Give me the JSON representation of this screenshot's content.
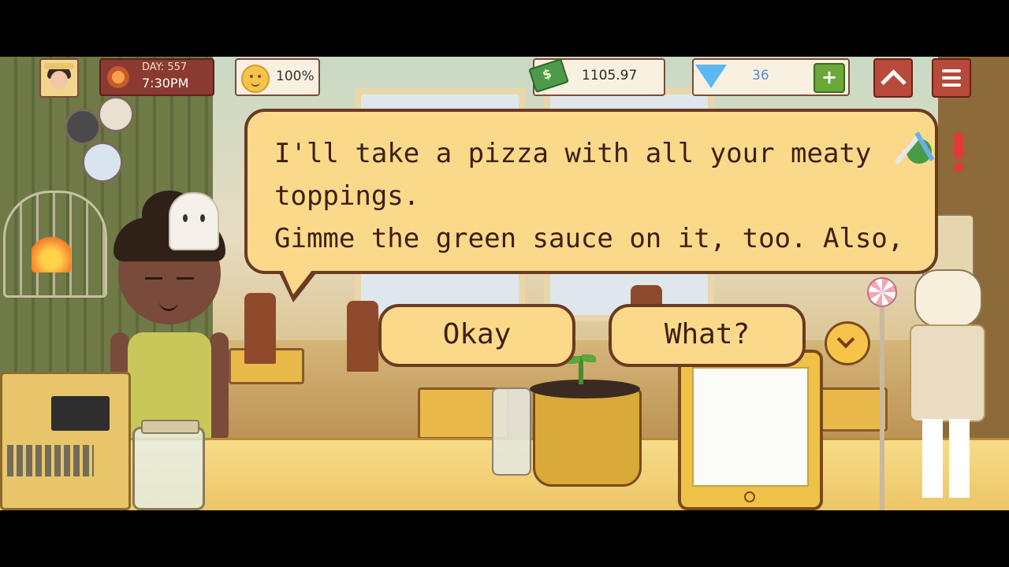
{
  "hud": {
    "day": "DAY: 557",
    "time": "7:30PM",
    "mood": "100%",
    "money": "1105.97",
    "gems": "36",
    "gem_plus": "+"
  },
  "dialog": {
    "text": "I'll take a pizza with all your meaty toppings.\nGimme the green sauce on it, too. Also, make\nit dark."
  },
  "choices": {
    "okay": "Okay",
    "what": "What?"
  },
  "colors": {
    "bubble": "#fbd98b",
    "bubble_border": "#6a3a22",
    "hud_dark": "#8a3a30"
  },
  "icons": [
    "avatar",
    "sun-icon",
    "mood-face-icon",
    "money-icon",
    "gem-icon",
    "plus-icon",
    "chevron-up-icon",
    "menu-icon",
    "chevron-down-icon",
    "tools-icon",
    "alert-icon"
  ]
}
